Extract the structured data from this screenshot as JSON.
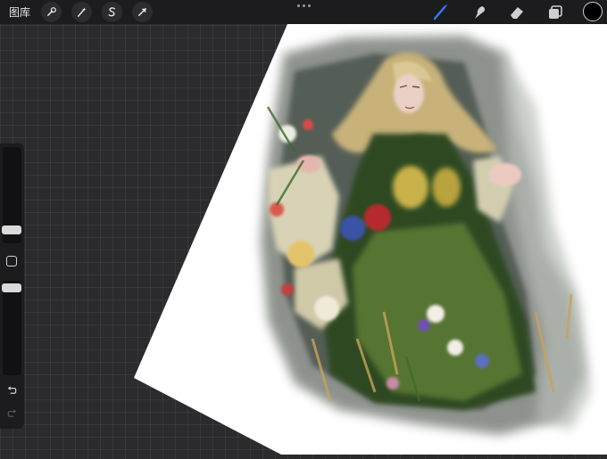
{
  "toolbar": {
    "gallery_label": "图库",
    "left_tools": [
      "wrench-icon",
      "magic-wand-icon",
      "selection-s-icon",
      "transform-arrow-icon"
    ],
    "right_tools": [
      "brush-icon",
      "smudge-icon",
      "eraser-icon",
      "layers-icon"
    ],
    "active_tool": "brush-icon",
    "accent_color": "#2f7df6",
    "current_color": "#000000"
  },
  "sidebar": {
    "brush_size_level": 0.55,
    "opacity_level": 0.55,
    "icons": [
      "modify-square-icon",
      "undo-icon",
      "redo-icon"
    ]
  },
  "canvas": {
    "background_color": "#ffffff",
    "workspace_color": "#2b2b2d",
    "artwork_palette": {
      "hair": "#c8b27a",
      "dress": "#3e5a2a",
      "sleeve": "#d8d2b6",
      "skin": "#e9c9bf",
      "shadow": "#2f3a33"
    }
  }
}
